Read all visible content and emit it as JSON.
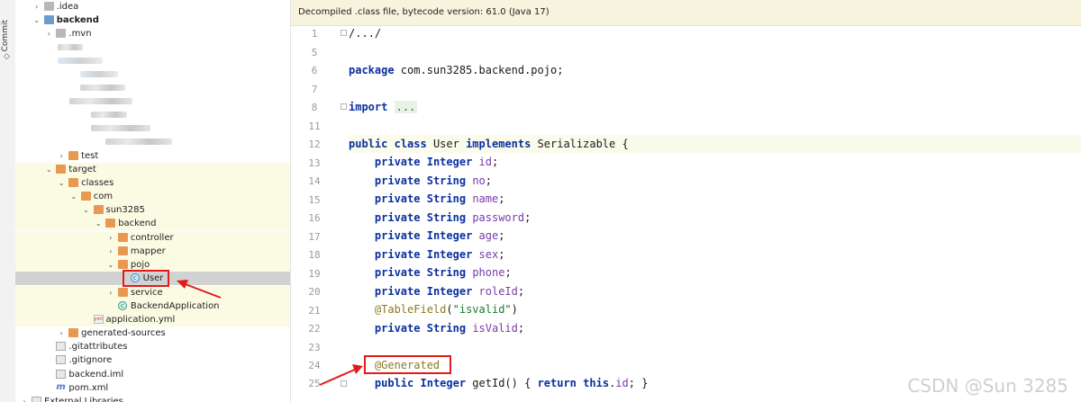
{
  "sidebar_strip": {
    "label": "Commit"
  },
  "tree": {
    "rows": [
      {
        "label": ".idea",
        "indent": 1,
        "chevron": ">",
        "icon": "folder-gray"
      },
      {
        "label": "backend",
        "indent": 1,
        "chevron": "v",
        "icon": "module",
        "bold": true
      },
      {
        "label": ".mvn",
        "indent": 2,
        "chevron": ">",
        "icon": "folder-gray"
      },
      {
        "label": "test",
        "indent": 3,
        "chevron": ">",
        "icon": "folder"
      },
      {
        "label": "target",
        "indent": 2,
        "chevron": "v",
        "icon": "folder"
      },
      {
        "label": "classes",
        "indent": 3,
        "chevron": "v",
        "icon": "folder"
      },
      {
        "label": "com",
        "indent": 4,
        "chevron": "v",
        "icon": "folder"
      },
      {
        "label": "sun3285",
        "indent": 5,
        "chevron": "v",
        "icon": "folder"
      },
      {
        "label": "backend",
        "indent": 6,
        "chevron": "v",
        "icon": "folder"
      },
      {
        "label": "controller",
        "indent": 7,
        "chevron": ">",
        "icon": "folder"
      },
      {
        "label": "mapper",
        "indent": 7,
        "chevron": ">",
        "icon": "folder"
      },
      {
        "label": "pojo",
        "indent": 7,
        "chevron": "v",
        "icon": "folder"
      },
      {
        "label": "User",
        "indent": 8,
        "chevron": "",
        "icon": "class"
      },
      {
        "label": "service",
        "indent": 7,
        "chevron": ">",
        "icon": "folder"
      },
      {
        "label": "BackendApplication",
        "indent": 7,
        "chevron": "",
        "icon": "class-app"
      },
      {
        "label": "application.yml",
        "indent": 5,
        "chevron": "",
        "icon": "yml"
      },
      {
        "label": "generated-sources",
        "indent": 3,
        "chevron": ">",
        "icon": "folder"
      },
      {
        "label": ".gitattributes",
        "indent": 2,
        "chevron": "",
        "icon": "file"
      },
      {
        "label": ".gitignore",
        "indent": 2,
        "chevron": "",
        "icon": "file"
      },
      {
        "label": "backend.iml",
        "indent": 2,
        "chevron": "",
        "icon": "file"
      },
      {
        "label": "pom.xml",
        "indent": 2,
        "chevron": "",
        "icon": "maven"
      },
      {
        "label": "External Libraries",
        "indent": 0,
        "chevron": ">",
        "icon": "library"
      }
    ]
  },
  "editor": {
    "banner": "Decompiled .class file, bytecode version: 61.0 (Java 17)",
    "line_numbers": [
      "1",
      "5",
      "6",
      "7",
      "8",
      "11",
      "12",
      "13",
      "14",
      "15",
      "16",
      "17",
      "18",
      "19",
      "20",
      "21",
      "22",
      "23",
      "24",
      "25"
    ],
    "code": {
      "l1": "/.../",
      "l6_kw": "package",
      "l6_rest": " com.sun3285.backend.pojo;",
      "l8_kw": "import",
      "l8_fold": "...",
      "l12_public": "public",
      "l12_class": "class",
      "l12_name": " User ",
      "l12_impl": "implements",
      "l12_rest": " Serializable {",
      "private": "private",
      "fields": [
        {
          "type": "Integer",
          "name": "id"
        },
        {
          "type": "String",
          "name": "no"
        },
        {
          "type": "String",
          "name": "name"
        },
        {
          "type": "String",
          "name": "password"
        },
        {
          "type": "Integer",
          "name": "age"
        },
        {
          "type": "Integer",
          "name": "sex"
        },
        {
          "type": "String",
          "name": "phone"
        },
        {
          "type": "Integer",
          "name": "roleId"
        }
      ],
      "l21_ann": "@TableField",
      "l21_open": "(",
      "l21_str": "\"isvalid\"",
      "l21_close": ")",
      "l22_type": "String",
      "l22_name": "isValid",
      "l24_ann": "@Generated",
      "l25_public": "public",
      "l25_type": "Integer",
      "l25_method": " getId() { ",
      "l25_return": "return",
      "l25_this": "this",
      "l25_field": "id",
      "l25_end": "; }"
    }
  },
  "watermark": "CSDN @Sun 3285",
  "colors": {
    "annotation_red": "#e01b1b",
    "banner_bg": "#f7f3de",
    "keyword": "#0b2fa0"
  }
}
